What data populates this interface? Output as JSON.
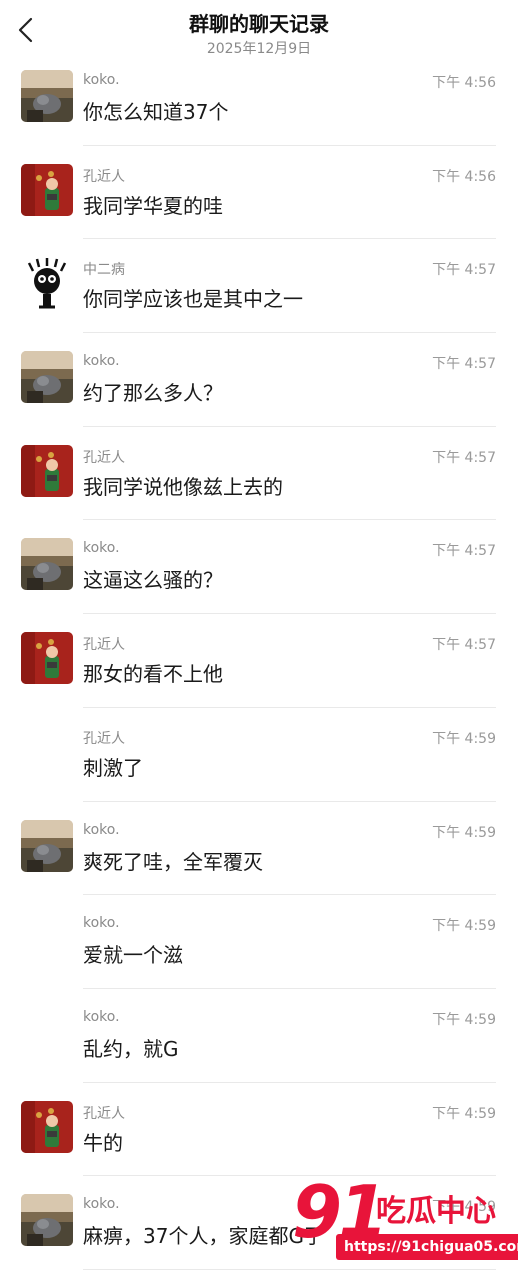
{
  "header": {
    "title": "群聊的聊天记录",
    "date": "2025年12月9日"
  },
  "messages": [
    {
      "sender": "koko.",
      "time": "下午 4:56",
      "text": "你怎么知道37个",
      "avatar": "landscape-avatar"
    },
    {
      "sender": "孔近人",
      "time": "下午 4:56",
      "text": "我同学华夏的哇",
      "avatar": "red-wall-avatar"
    },
    {
      "sender": "中二病",
      "time": "下午 4:57",
      "text": "你同学应该也是其中之一",
      "avatar": "cartoon-avatar"
    },
    {
      "sender": "koko.",
      "time": "下午 4:57",
      "text": "约了那么多人？",
      "avatar": "landscape-avatar"
    },
    {
      "sender": "孔近人",
      "time": "下午 4:57",
      "text": "我同学说他像兹上去的",
      "avatar": "red-wall-avatar"
    },
    {
      "sender": "koko.",
      "time": "下午 4:57",
      "text": "这逼这么骚的？",
      "avatar": "landscape-avatar"
    },
    {
      "sender": "孔近人",
      "time": "下午 4:57",
      "text": "那女的看不上他",
      "avatar": "red-wall-avatar"
    },
    {
      "sender": "孔近人",
      "time": "下午 4:59",
      "text": "刺激了",
      "avatar": ""
    },
    {
      "sender": "koko.",
      "time": "下午 4:59",
      "text": "爽死了哇，全军覆灭",
      "avatar": "landscape-avatar"
    },
    {
      "sender": "koko.",
      "time": "下午 4:59",
      "text": "爱就一个滋",
      "avatar": ""
    },
    {
      "sender": "koko.",
      "time": "下午 4:59",
      "text": "乱约，就G",
      "avatar": ""
    },
    {
      "sender": "孔近人",
      "time": "下午 4:59",
      "text": "牛的",
      "avatar": "red-wall-avatar"
    },
    {
      "sender": "koko.",
      "time": "下午 4:59",
      "text": "麻痹，37个人，家庭都G了",
      "avatar": "landscape-avatar"
    }
  ],
  "watermark": {
    "number": "91",
    "name": "吃瓜中心",
    "url": "https://91chigua05.com"
  },
  "colors": {
    "accent": "#e8143a",
    "meta_text": "#8a8a8a",
    "divider": "#e9e9e9"
  }
}
